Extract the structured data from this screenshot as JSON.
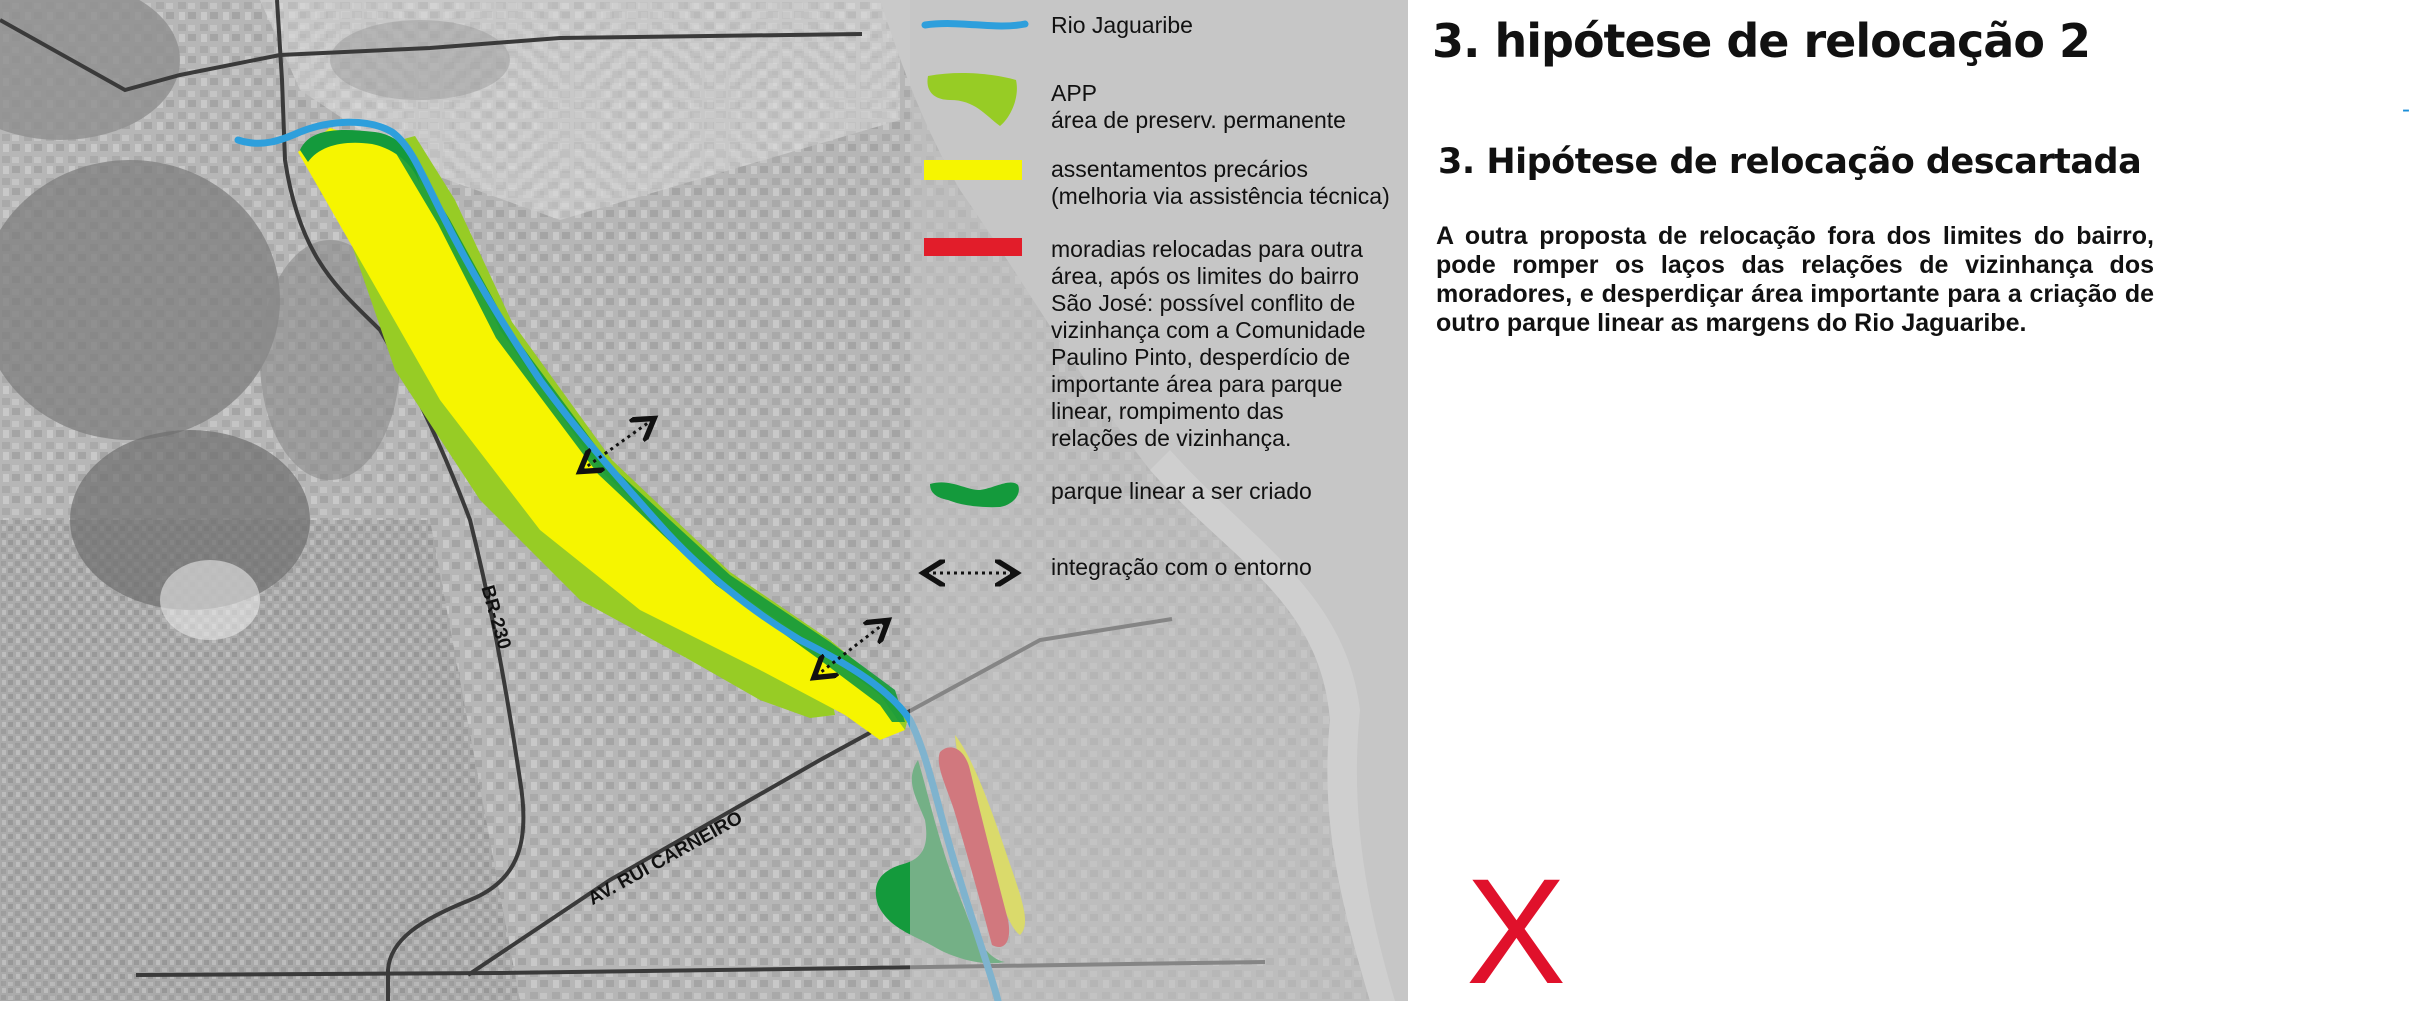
{
  "slide": {
    "title": "3. hipótese de relocação 2",
    "subtitle": "3. Hipótese de relocação descartada",
    "body": "A outra proposta de relocação fora dos limites do bairro, pode romper os laços das relações de vizinhança dos moradores, e desperdiçar área importante para a criação de outro parque linear as margens do Rio Jaguaribe.",
    "dash_mark": "-",
    "reject_mark": "X"
  },
  "map": {
    "road_labels": {
      "br230": "BR-230",
      "rui_carneiro": "AV. RUI CARNEIRO"
    },
    "legend": [
      {
        "key": "river",
        "label": "Rio Jaguaribe",
        "color": "#2e9fdc"
      },
      {
        "key": "app",
        "label": "APP\nárea de preserv. permanente",
        "color": "#97cc25"
      },
      {
        "key": "settlements",
        "label": "assentamentos precários\n(melhoria via assistência técnica)",
        "color": "#f6f500"
      },
      {
        "key": "relocated",
        "label": "moradias relocadas para outra\nárea, após os limites do bairro\nSão José: possível conflito de\nvizinhança com a Comunidade\nPaulino Pinto, desperdício de\nimportante área para parque\nlinear, rompimento das\nrelações de vizinhança.",
        "color": "#e21d2a"
      },
      {
        "key": "park",
        "label": "parque linear a ser criado",
        "color": "#149a3c"
      },
      {
        "key": "integration",
        "label": "integração com o entorno",
        "color": "#111111"
      }
    ]
  },
  "colors": {
    "river": "#2e9fdc",
    "app": "#97cc25",
    "settlements": "#f6f500",
    "relocated": "#e21d2a",
    "park": "#149a3c",
    "road": "#3a3a3a",
    "reject": "#e0112b"
  }
}
